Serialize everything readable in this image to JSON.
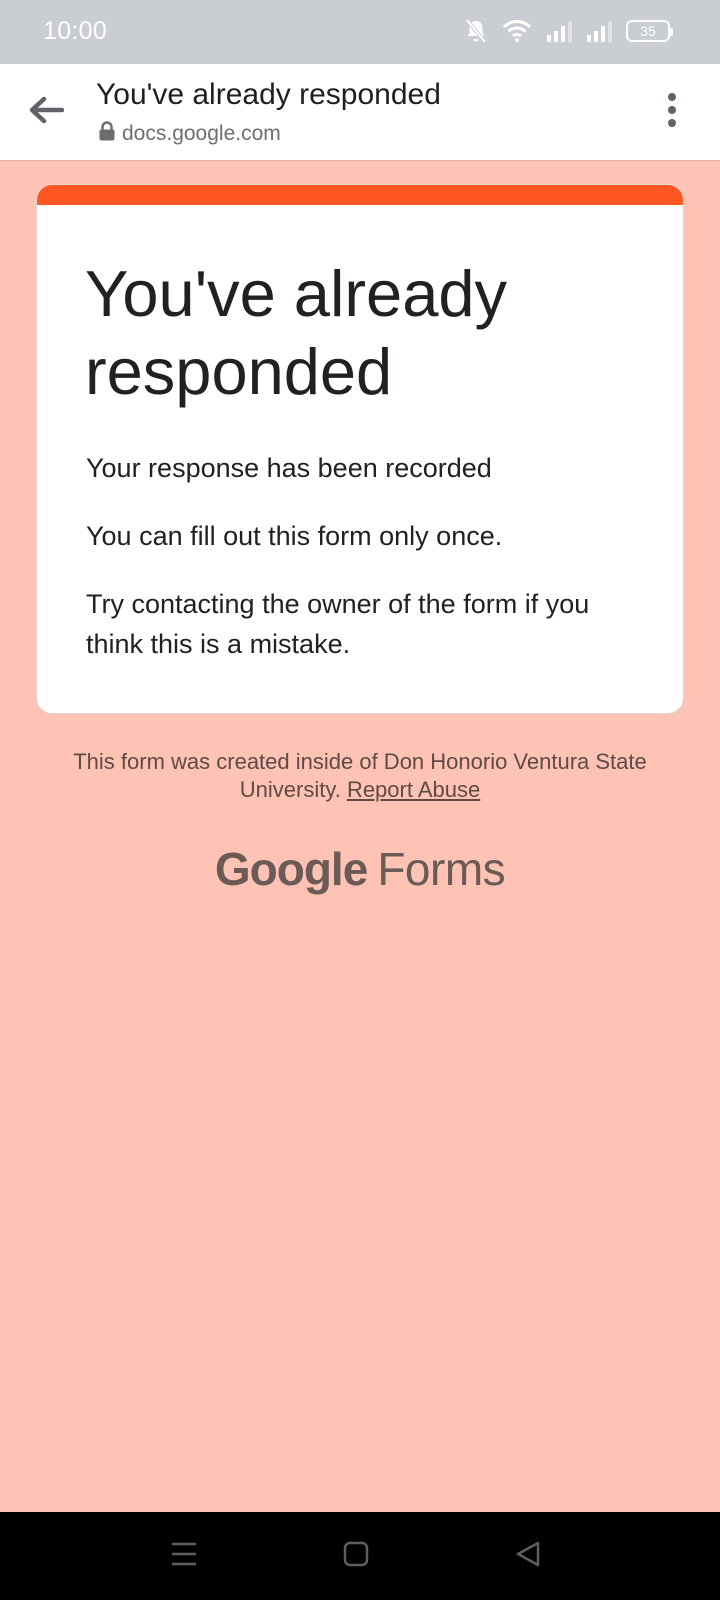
{
  "status_bar": {
    "time": "10:00",
    "battery": "35",
    "icons": [
      "bell-off-icon",
      "wifi-icon",
      "signal-icon",
      "signal-icon",
      "battery-icon"
    ]
  },
  "browser": {
    "title": "You've already responded",
    "url": "docs.google.com",
    "icons": [
      "back-arrow-icon",
      "lock-icon",
      "more-vert-icon"
    ]
  },
  "card": {
    "heading": "You've already responded",
    "line1": "Your response has been recorded",
    "line2": "You can fill out this form only once.",
    "line3": "Try contacting the owner of the form if you think this is a mistake."
  },
  "footer": {
    "created_text": "This form was created inside of Don Honorio Ventura State University.",
    "report_link": "Report Abuse",
    "brand_google": "Google",
    "brand_product": "Forms"
  },
  "nav_bar": {
    "icons": [
      "menu-icon",
      "home-square-icon",
      "back-triangle-icon"
    ]
  },
  "colors": {
    "page_background": "#fec3b4",
    "accent": "#ff5722",
    "status_bar": "#cacdd2",
    "nav_bar": "#000000"
  }
}
